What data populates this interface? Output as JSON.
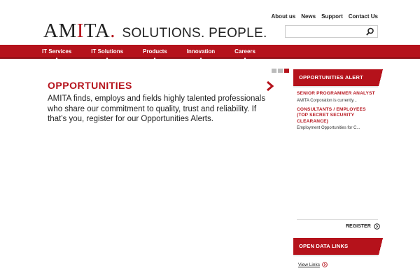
{
  "header": {
    "logo_brand_pre": "AM",
    "logo_brand_red": "I",
    "logo_brand_post": "TA",
    "logo_dot": ".",
    "tagline": "SOLUTIONS. PEOPLE.",
    "top_links": [
      "About us",
      "News",
      "Support",
      "Contact Us"
    ],
    "search": {
      "value": "",
      "icon": "search-icon"
    }
  },
  "nav": {
    "items": [
      "IT Services",
      "IT Solutions",
      "Products",
      "Innovation",
      "Careers"
    ]
  },
  "slider": {
    "total": 3,
    "active_index": 3
  },
  "main": {
    "title": "OPPORTUNITIES",
    "body": "AMITA finds, employs and fields highly talented professionals who share our commitment to quality, trust and reliability. If that’s you, register for our Opportunities Alerts.",
    "next_icon": "chevron-right-icon"
  },
  "sidebar": {
    "alerts_header": "OPPORTUNITIES ALERT",
    "alerts": [
      {
        "title": "SENIOR PROGRAMMER ANALYST",
        "desc": "AMITA Corporation is currently..."
      },
      {
        "title": "CONSULTANTS / EMPLOYEES (TOP SECRET SECURITY CLEARANCE)",
        "desc": "Employment Opportunities for C..."
      }
    ],
    "register_label": "REGISTER",
    "open_data_header": "OPEN DATA LINKS",
    "view_links_label": "View Links"
  },
  "colors": {
    "brand_red": "#b5121b",
    "text": "#222222"
  }
}
